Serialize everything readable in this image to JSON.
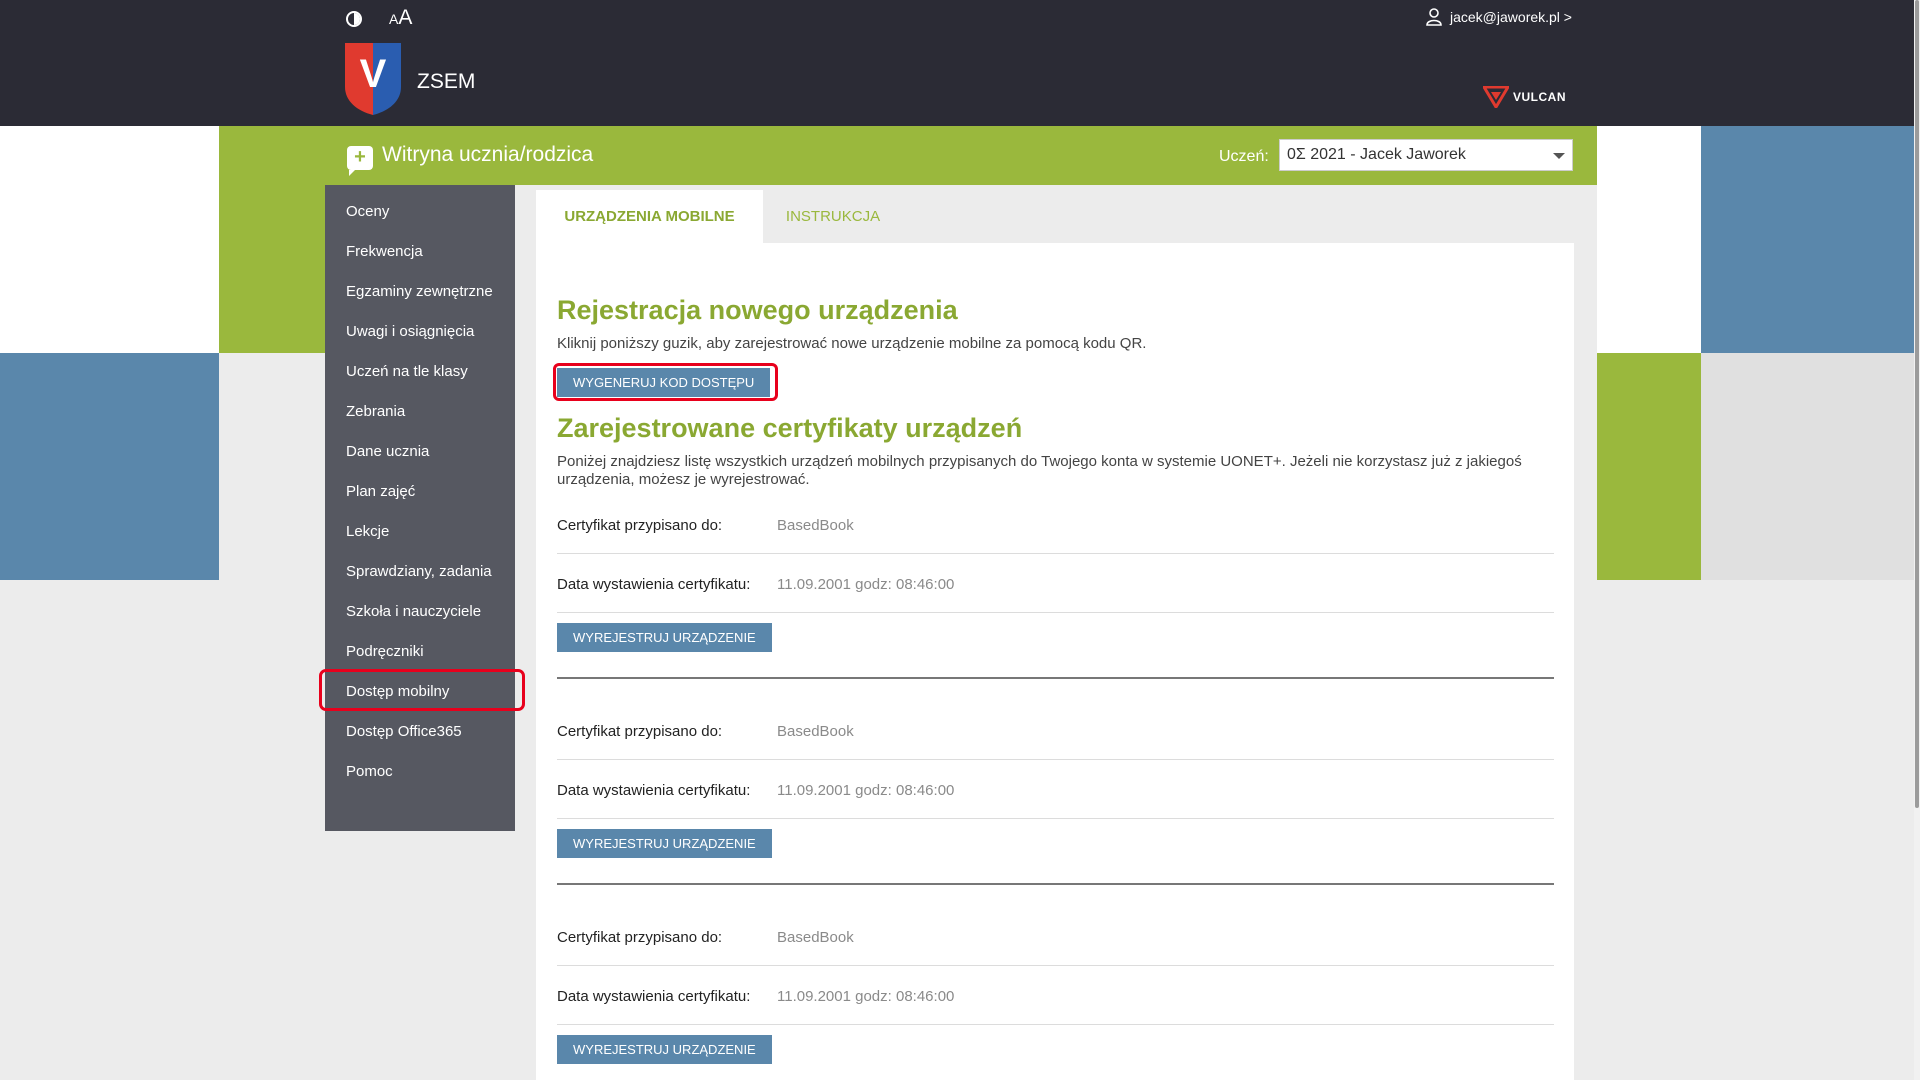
{
  "header": {
    "contrast_icon": "contrast-icon",
    "font_small": "A",
    "font_big": "A",
    "user_email": "jacek@jaworek.pl >",
    "school": "ZSEM",
    "logo_letter": "V",
    "vendor": "VULCAN"
  },
  "site": {
    "title": "Witryna ucznia/rodzica",
    "icon_glyph": "+",
    "student_label": "Uczeń:",
    "student_value": "0Σ 2021 - Jacek Jaworek"
  },
  "sidebar": {
    "items": [
      "Oceny",
      "Frekwencja",
      "Egzaminy zewnętrzne",
      "Uwagi i osiągnięcia",
      "Uczeń na tle klasy",
      "Zebrania",
      "Dane ucznia",
      "Plan zajęć",
      "Lekcje",
      "Sprawdziany, zadania",
      "Szkoła i nauczyciele",
      "Podręczniki",
      "Dostęp mobilny",
      "Dostęp Office365",
      "Pomoc"
    ],
    "active": "Dostęp mobilny"
  },
  "tabs": [
    "URZĄDZENIA MOBILNE",
    "INSTRUKCJA"
  ],
  "register": {
    "heading": "Rejestracja nowego urządzenia",
    "description": "Kliknij poniższy guzik, aby zarejestrować nowe urządzenie mobilne za pomocą kodu QR.",
    "button": "WYGENERUJ KOD DOSTĘPU"
  },
  "certificates": {
    "heading": "Zarejestrowane certyfikaty urządzeń",
    "description": "Poniżej znajdziesz listę wszystkich urządzeń mobilnych przypisanych do Twojego konta w systemie UONET+. Jeżeli nie korzystasz już z jakiegoś urządzenia, możesz je wyrejestrować.",
    "assigned_label": "Certyfikat przypisano do:",
    "date_label": "Data wystawienia certyfikatu:",
    "unregister_button": "WYREJESTRUJ URZĄDZENIE",
    "items": [
      {
        "device": "BasedBook",
        "date": "11.09.2001 godz: 08:46:00"
      },
      {
        "device": "BasedBook",
        "date": "11.09.2001 godz: 08:46:00"
      },
      {
        "device": "BasedBook",
        "date": "11.09.2001 godz: 08:46:00"
      }
    ]
  },
  "colors": {
    "topbar": "#2b2b35",
    "green": "#9ab83d",
    "blue": "#5a87ab",
    "sidebar": "#565861",
    "highlight": "#e8001c"
  }
}
